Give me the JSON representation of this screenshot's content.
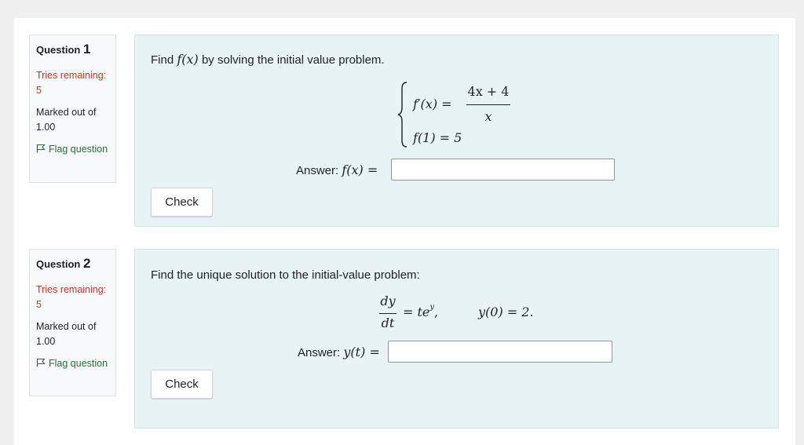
{
  "questions": [
    {
      "label": "Question",
      "number": "1",
      "tries": "Tries remaining: 5",
      "marked": "Marked out of 1.00",
      "flag": "Flag question",
      "prompt_before": "Find",
      "prompt_fx": "f(x)",
      "prompt_after": "by solving the initial value problem.",
      "eq1_lhs": "f′(x) =",
      "eq1_num": "4x + 4",
      "eq1_den": "x",
      "eq2": "f(1) = 5",
      "answer_label": "Answer:",
      "answer_var": "f(x) =",
      "answer_value": "",
      "check": "Check"
    },
    {
      "label": "Question",
      "number": "2",
      "tries": "Tries remaining: 5",
      "marked": "Marked out of 1.00",
      "flag": "Flag question",
      "prompt": "Find the unique solution to the initial-value problem:",
      "eq_num": "dy",
      "eq_den": "dt",
      "eq_rhs": "= te",
      "eq_sup": "y",
      "eq_comma": ",",
      "eq_ic": "y(0) = 2.",
      "answer_label": "Answer:",
      "answer_var": "y(t) =",
      "answer_value": "",
      "check": "Check"
    }
  ],
  "colors": {
    "tries": "#ca3120",
    "flag": "#2b6c35",
    "content_bg": "#e7f3f5"
  },
  "icons": {
    "flag": "flag-icon"
  }
}
